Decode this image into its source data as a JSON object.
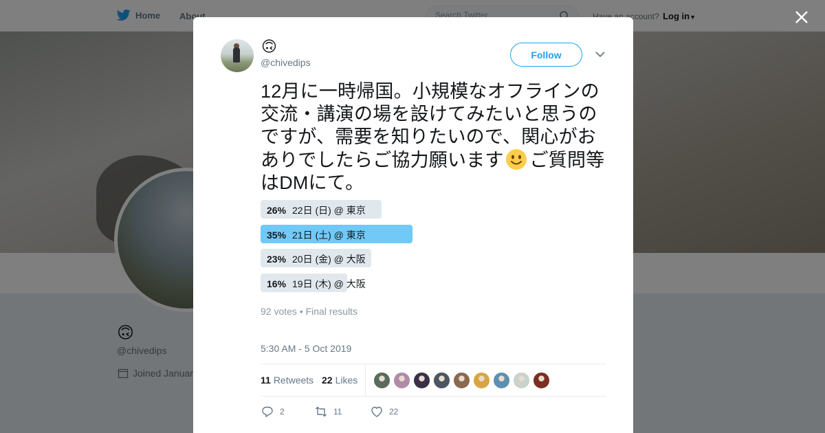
{
  "topbar": {
    "home_label": "Home",
    "about_label": "About",
    "search_placeholder": "Search Twitter",
    "account_prompt": "Have an account?",
    "login_label": "Log in"
  },
  "profile": {
    "name_emoji": "🙃",
    "handle": "@chivedips",
    "joined": "Joined Januar"
  },
  "tweet": {
    "name_emoji": "🙃",
    "handle": "@chivedips",
    "follow_label": "Follow",
    "text_part1": "12月に一時帰国。小規模なオフラインの交流・講演の場を設けてみたいと思うのですが、需要を知りたいので、関心がおありでしたらご協力願います",
    "text_part2": "ご質問等はDMにて。",
    "timestamp": "5:30 AM - 5 Oct 2019",
    "poll": {
      "options": [
        {
          "pct_label": "26%",
          "percent": 26,
          "label": "22日 (日) @ 東京",
          "winner": false
        },
        {
          "pct_label": "35%",
          "percent": 35,
          "label": "21日 (土) @ 東京",
          "winner": true
        },
        {
          "pct_label": "23%",
          "percent": 23,
          "label": "20日 (金) @ 大阪",
          "winner": false
        },
        {
          "pct_label": "16%",
          "percent": 16,
          "label": "19日 (木) @ 大阪",
          "winner": false
        }
      ],
      "meta": "92 votes • Final results"
    },
    "stats": {
      "retweets_count": "11",
      "retweets_label": "Retweets",
      "likes_count": "22",
      "likes_label": "Likes"
    },
    "likers_colors": [
      "#5a6b5c",
      "#b08aa8",
      "#3a3147",
      "#4c5560",
      "#8a6a50",
      "#d9a441",
      "#5f8fb0",
      "#c9d3cc",
      "#7a2f22"
    ],
    "actions": {
      "reply_count": "2",
      "retweet_count": "11",
      "like_count": "22"
    }
  },
  "colors": {
    "accent": "#1da1f2",
    "poll_winner": "#71c9f8",
    "poll_other": "#e1e8ed"
  }
}
